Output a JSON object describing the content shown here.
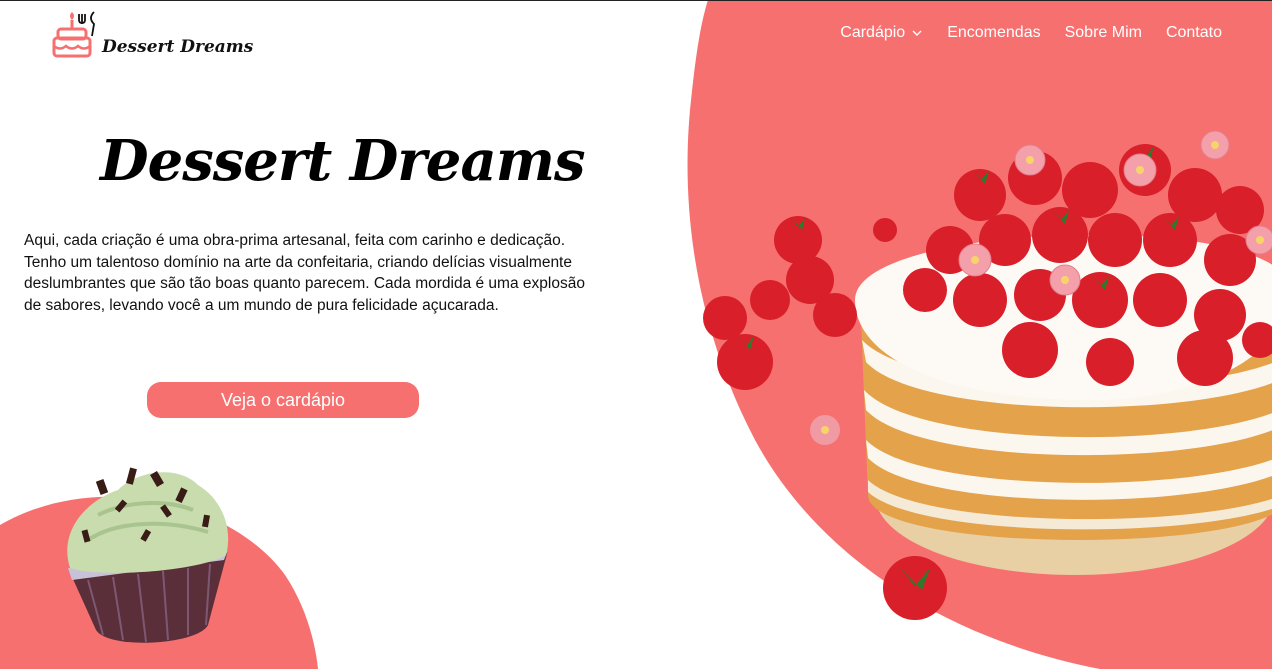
{
  "brand": {
    "name": "Dessert Dreams",
    "accent_color": "#f77070",
    "logo_icon": "cake-icon"
  },
  "nav": {
    "items": [
      {
        "label": "Cardápio",
        "has_dropdown": true
      },
      {
        "label": "Encomendas"
      },
      {
        "label": "Sobre Mim"
      },
      {
        "label": "Contato"
      }
    ]
  },
  "hero": {
    "title": "Dessert Dreams",
    "description": "Aqui, cada criação é uma obra-prima artesanal, feita com carinho e dedicação. Tenho um talentoso domínio na arte da confeitaria, criando delícias visualmente deslumbrantes que são tão boas quanto parecem. Cada mordida é uma explosão de sabores, levando você a um mundo de pura felicidade açucarada.",
    "cta_label": "Veja o cardápio"
  },
  "images": {
    "hero_image": "strawberry-cake-image",
    "decor_image": "cupcake-image"
  }
}
